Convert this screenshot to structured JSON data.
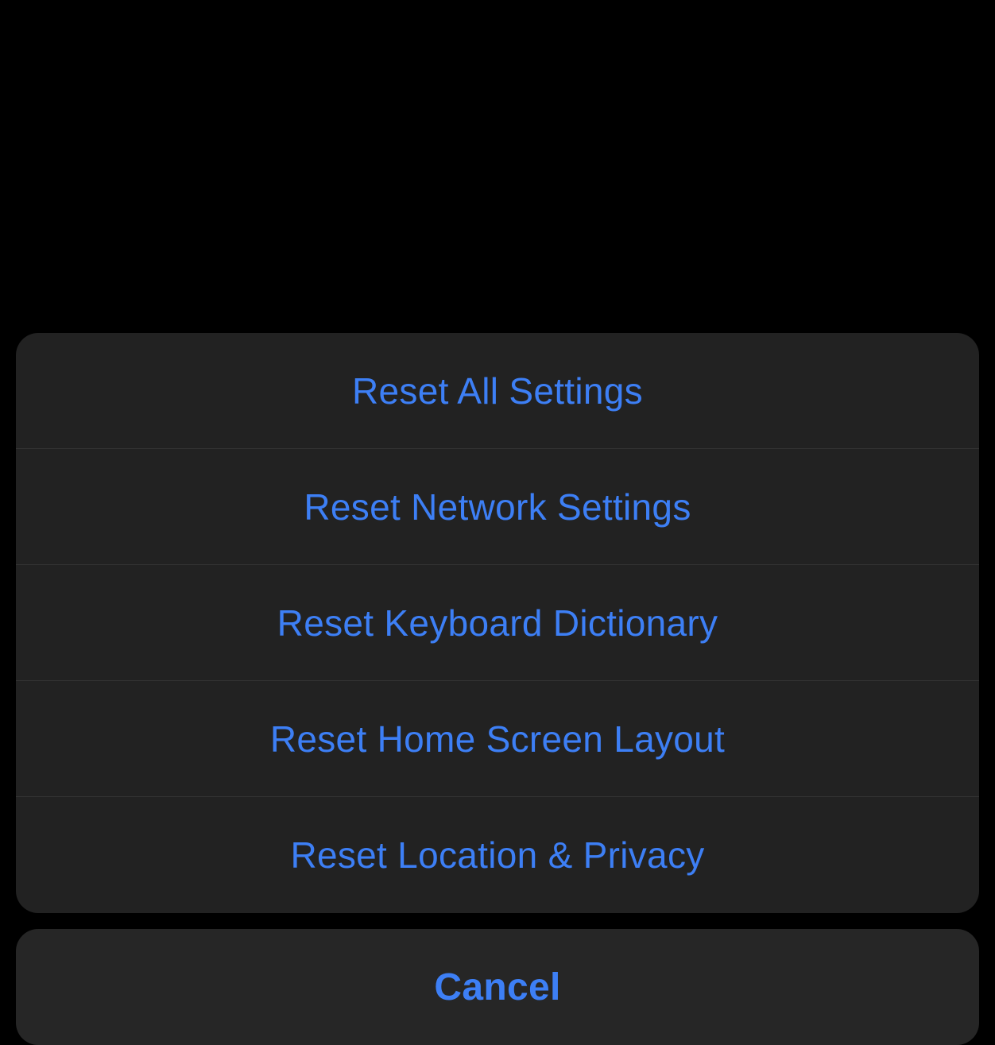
{
  "actionSheet": {
    "items": [
      {
        "label": "Reset All Settings",
        "id": "reset-all-settings"
      },
      {
        "label": "Reset Network Settings",
        "id": "reset-network-settings"
      },
      {
        "label": "Reset Keyboard Dictionary",
        "id": "reset-keyboard-dictionary"
      },
      {
        "label": "Reset Home Screen Layout",
        "id": "reset-home-screen-layout"
      },
      {
        "label": "Reset Location & Privacy",
        "id": "reset-location-privacy"
      }
    ],
    "cancelLabel": "Cancel"
  },
  "colors": {
    "background": "#000000",
    "sheetBackground": "#222222",
    "cancelBackground": "#262626",
    "actionText": "#3d7ff5",
    "separator": "#333333"
  }
}
